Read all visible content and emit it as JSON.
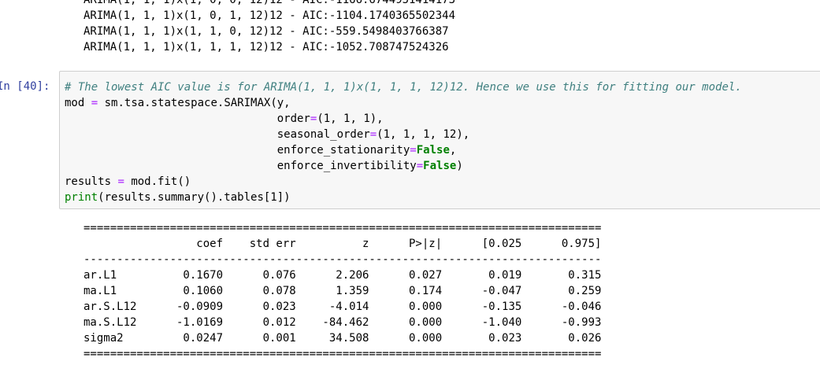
{
  "top_output": {
    "line_partial": "ARIMA(1, 1, 1)x(1, 0, 0, 12)12 - AIC:-1166.6744951414173",
    "line1": "ARIMA(1, 1, 1)x(1, 0, 1, 12)12 - AIC:-1104.1740365502344",
    "line2": "ARIMA(1, 1, 1)x(1, 1, 0, 12)12 - AIC:-559.5498403766387",
    "line3": "ARIMA(1, 1, 1)x(1, 1, 1, 12)12 - AIC:-1052.708747524326"
  },
  "cell": {
    "prompt": "In [40]:",
    "comment": "# The lowest AIC value is for ARIMA(1, 1, 1)x(1, 1, 1, 12)12. Hence we use this for fitting our model.",
    "mod_var": "mod",
    "assign": "=",
    "sarimax_call": "sm.tsa.statespace.SARIMAX(y,",
    "order_kw": "order",
    "order_val": "(1, 1, 1),",
    "seasonal_kw": "seasonal_order",
    "seasonal_val": "(1, 1, 1, 12),",
    "stationarity_kw": "enforce_stationarity",
    "stationarity_val": "False",
    "invertibility_kw": "enforce_invertibility",
    "invertibility_val": "False",
    "results_var": "results",
    "fit_call": "mod.fit()",
    "print_fn": "print",
    "print_args": "(results.summary().tables[1])"
  },
  "summary_table": {
    "rule_double": "==============================================================================",
    "rule_single": "------------------------------------------------------------------------------",
    "header": "                 coef    std err          z      P>|z|      [0.025      0.975]",
    "rows": [
      "ar.L1          0.1670      0.076      2.206      0.027       0.019       0.315",
      "ma.L1          0.1060      0.078      1.359      0.174      -0.047       0.259",
      "ar.S.L12      -0.0909      0.023     -4.014      0.000      -0.135      -0.046",
      "ma.S.L12      -1.0169      0.012    -84.462      0.000      -1.040      -0.993",
      "sigma2         0.0247      0.001     34.508      0.000       0.023       0.026"
    ]
  }
}
